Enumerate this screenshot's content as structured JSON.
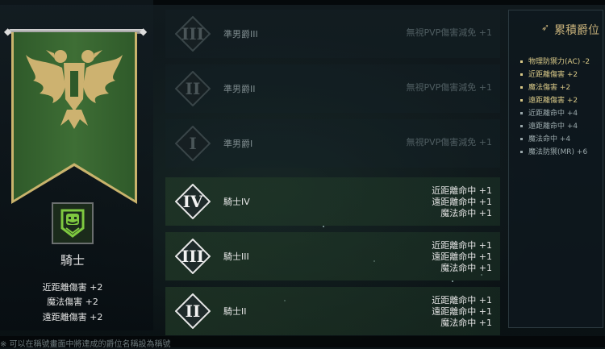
{
  "left_panel": {
    "class_name": "騎士",
    "stats": [
      "近距離傷害 +2",
      "魔法傷害 +2",
      "遠距離傷害 +2"
    ]
  },
  "ranks": [
    {
      "numeral": "III",
      "name": "準男爵III",
      "state": "locked",
      "effects": [
        "無視PVP傷害減免 +1"
      ]
    },
    {
      "numeral": "II",
      "name": "準男爵II",
      "state": "locked",
      "effects": [
        "無視PVP傷害減免 +1"
      ]
    },
    {
      "numeral": "I",
      "name": "準男爵I",
      "state": "locked",
      "effects": [
        "無視PVP傷害減免 +1"
      ]
    },
    {
      "numeral": "IV",
      "name": "騎士IV",
      "state": "active",
      "effects": [
        "近距離命中 +1",
        "遠距離命中 +1",
        "魔法命中 +1"
      ]
    },
    {
      "numeral": "III",
      "name": "騎士III",
      "state": "active",
      "effects": [
        "近距離命中 +1",
        "遠距離命中 +1",
        "魔法命中 +1"
      ]
    },
    {
      "numeral": "II",
      "name": "騎士II",
      "state": "active",
      "effects": [
        "近距離命中 +1",
        "遠距離命中 +1",
        "魔法命中 +1"
      ]
    }
  ],
  "right_panel": {
    "title": "累積爵位",
    "stats": [
      {
        "text": "物理防禦力(AC) -2",
        "tone": "gold"
      },
      {
        "text": "近距離傷害 +2",
        "tone": "gold"
      },
      {
        "text": "魔法傷害 +2",
        "tone": "gold"
      },
      {
        "text": "遠距離傷害 +2",
        "tone": "gold"
      },
      {
        "text": "近距離命中 +4",
        "tone": "dim"
      },
      {
        "text": "遠距離命中 +4",
        "tone": "dim"
      },
      {
        "text": "魔法命中 +4",
        "tone": "dim"
      },
      {
        "text": "魔法防禦(MR) +6",
        "tone": "dim"
      }
    ]
  },
  "footer": {
    "text": "※ 可以在稱號畫面中將達成的爵位名稱設為稱號"
  },
  "colors": {
    "banner_green": "#3e6e35",
    "gold": "#c9b36c",
    "icon_green": "#7ec840"
  }
}
